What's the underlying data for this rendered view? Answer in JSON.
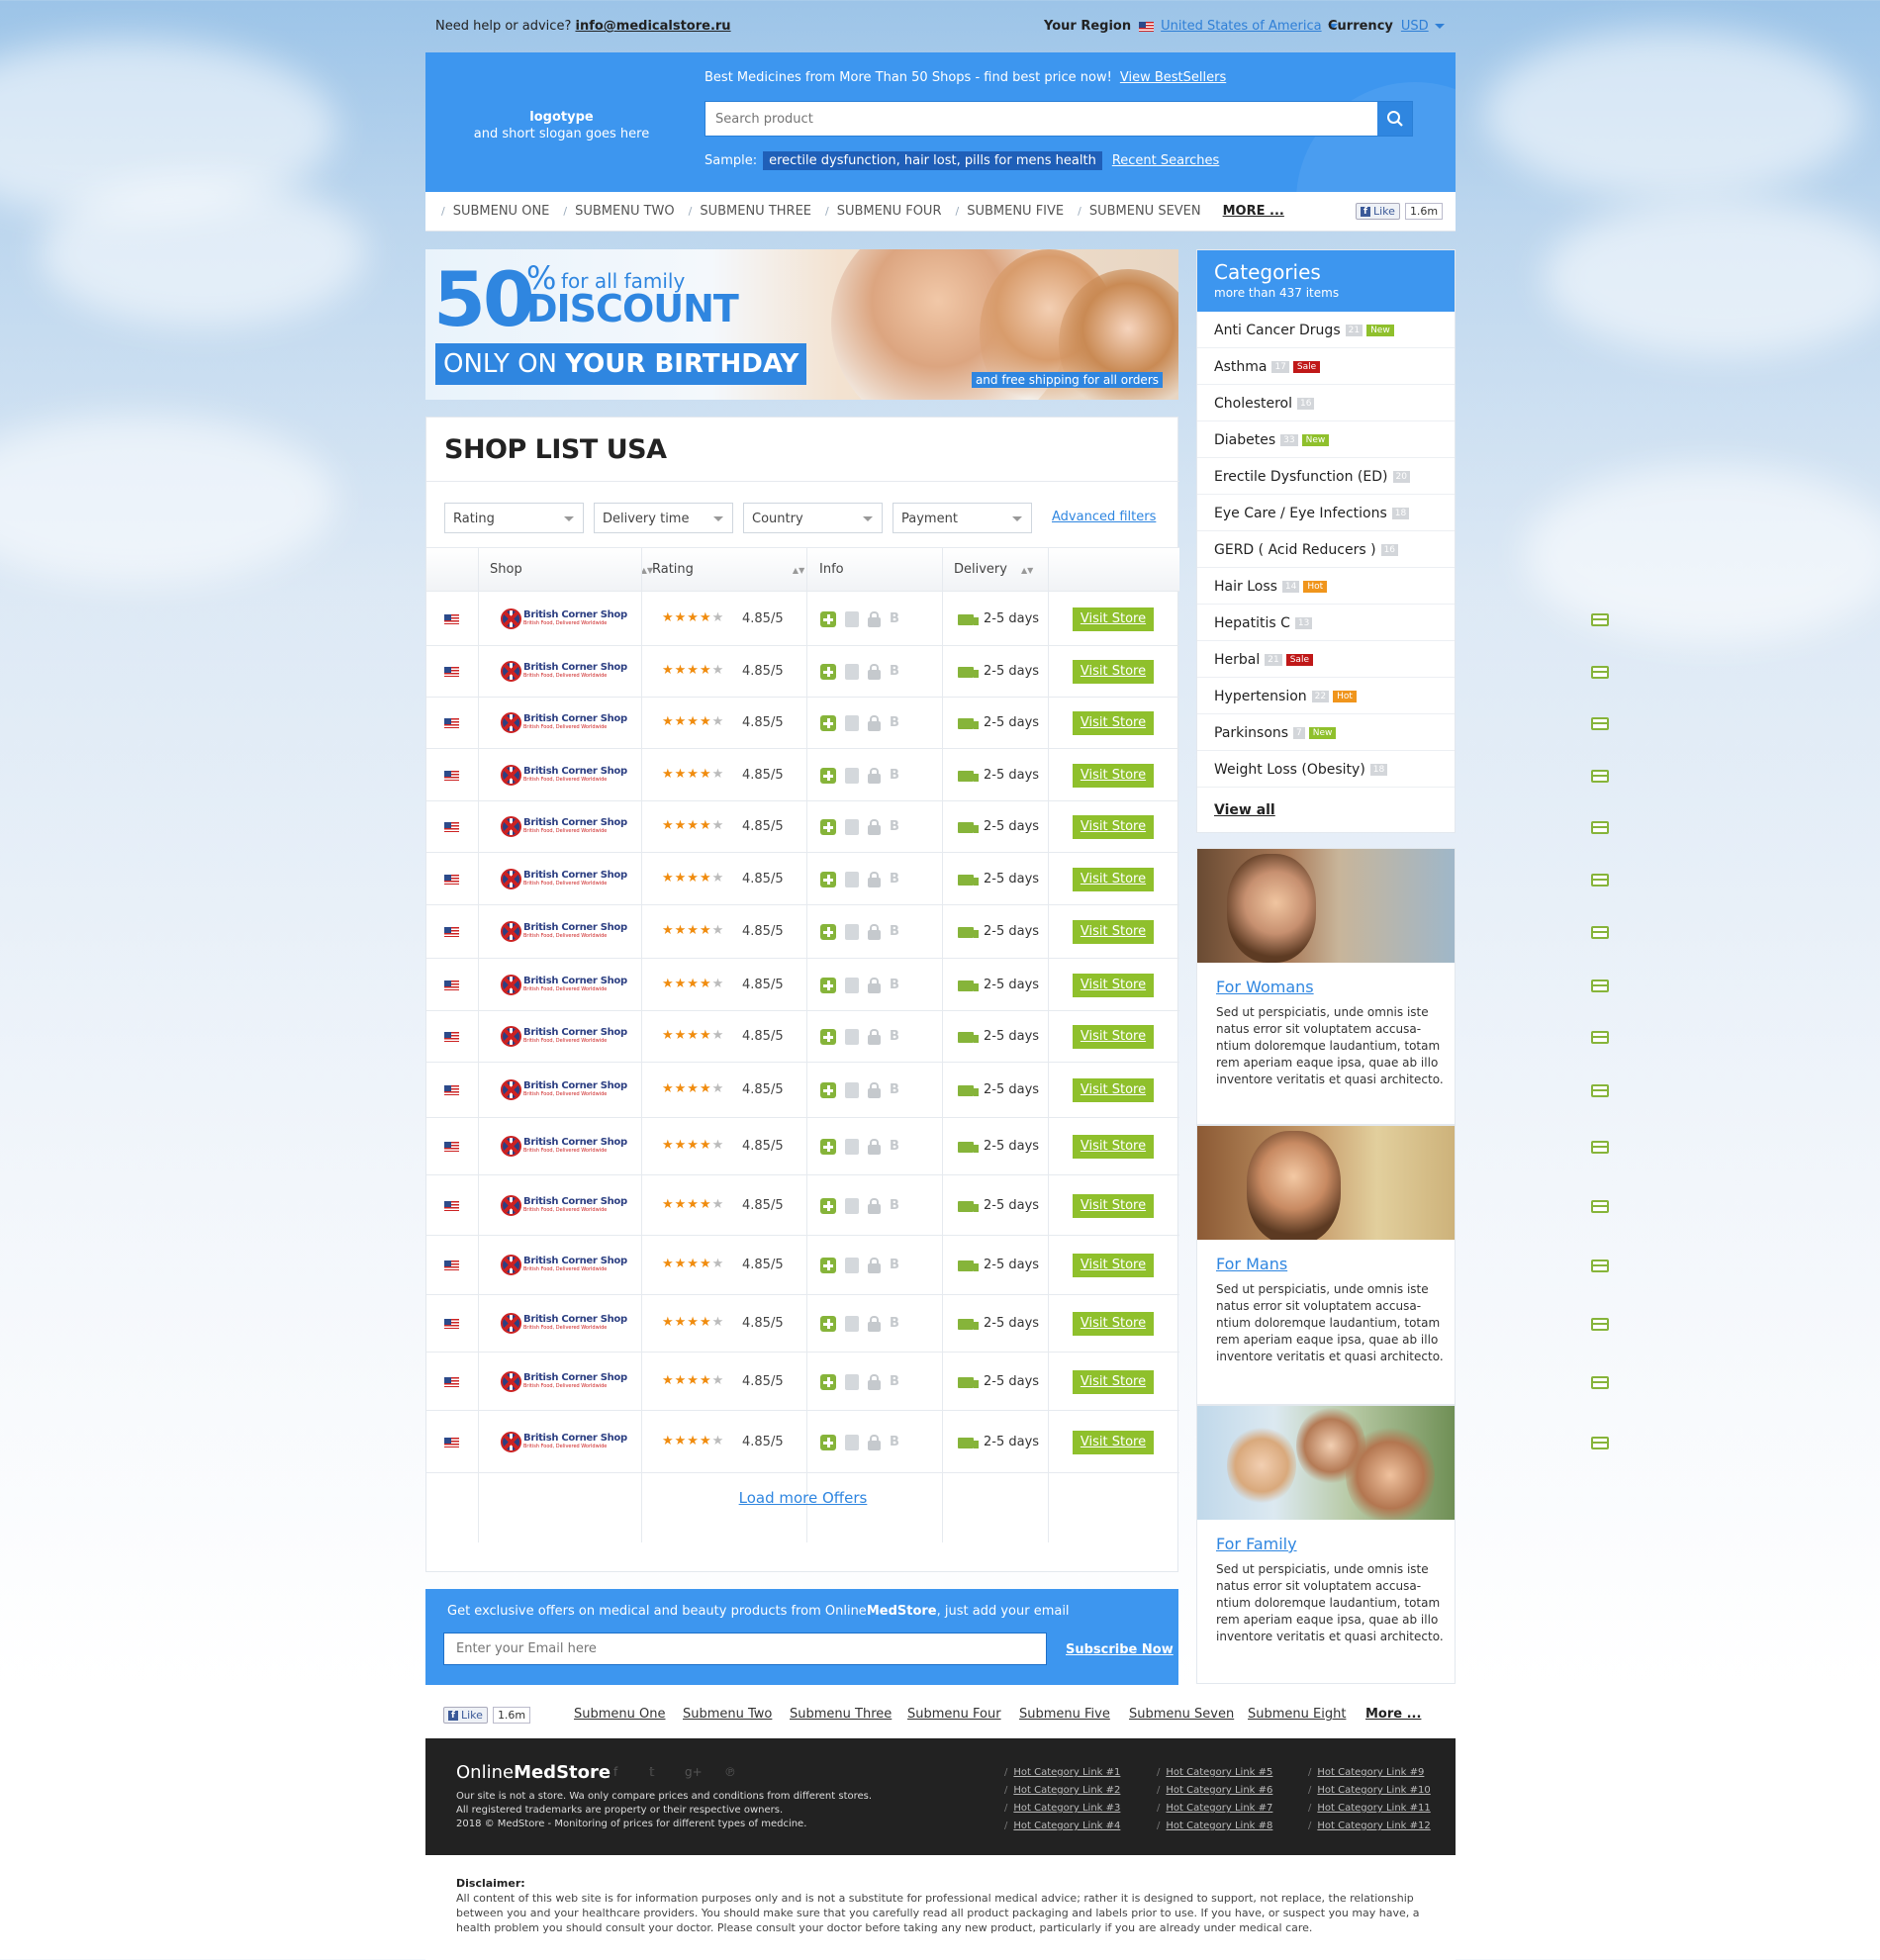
{
  "top": {
    "help_text": "Need help or advice?",
    "help_email": "info@medicalstore.ru",
    "region_label": "Your Region",
    "region_value": "United States of America",
    "currency_label": "Currency",
    "currency_value": "USD"
  },
  "header": {
    "logo_title": "logotype",
    "logo_slogan": "and short slogan goes here",
    "promo_text": "Best Medicines from More Than 50 Shops - find best price now!",
    "promo_link": "View BestSellers",
    "search_placeholder": "Search product",
    "sample_label": "Sample:",
    "sample_value": "erectile dysfunction, hair lost, pills for mens health",
    "recent_searches": "Recent Searches"
  },
  "menu": {
    "items": [
      "SUBMENU ONE",
      "SUBMENU TWO",
      "SUBMENU THREE",
      "SUBMENU FOUR",
      "SUBMENU FIVE",
      "SUBMENU SEVEN"
    ],
    "more": "MORE ...",
    "fb_like": "Like",
    "fb_count": "1.6m"
  },
  "banner": {
    "percent": "50",
    "percent_sign": "%",
    "for_family": "for all family",
    "discount": "DISCOUNT",
    "only_on": "ONLY ON",
    "your_birthday": "YOUR BIRTHDAY",
    "shipping": "and free shipping for all orders"
  },
  "shoplist": {
    "title": "SHOP LIST USA",
    "filters": [
      "Rating",
      "Delivery time",
      "Country",
      "Payment"
    ],
    "advanced": "Advanced filters",
    "columns": {
      "shop": "Shop",
      "rating": "Rating",
      "info": "Info",
      "delivery": "Delivery"
    },
    "shop_name": "British Corner Shop",
    "shop_tagline": "British Food, Delivered Worldwide",
    "score": "4.85/5",
    "delivery": "2-5 days",
    "visit": "Visit Store",
    "rating_stars": 4,
    "load_more": "Load more Offers"
  },
  "subscribe": {
    "text_pre": "Get exclusive offers on medical and beauty products from Online",
    "text_brand": "MedStore",
    "text_post": ", just add your email",
    "placeholder": "Enter your Email here",
    "button": "Subscribe Now"
  },
  "categories": {
    "title": "Categories",
    "subtitle": "more than 437 items",
    "items": [
      {
        "name": "Anti Cancer Drugs",
        "count": "21",
        "badge": "New"
      },
      {
        "name": "Asthma",
        "count": "17",
        "badge": "Sale"
      },
      {
        "name": "Cholesterol",
        "count": "16",
        "badge": ""
      },
      {
        "name": "Diabetes",
        "count": "33",
        "badge": "New"
      },
      {
        "name": "Erectile Dysfunction (ED)",
        "count": "20",
        "badge": ""
      },
      {
        "name": "Eye Care / Eye Infections",
        "count": "18",
        "badge": ""
      },
      {
        "name": "GERD ( Acid Reducers )",
        "count": "16",
        "badge": ""
      },
      {
        "name": "Hair Loss",
        "count": "14",
        "badge": "Hot"
      },
      {
        "name": "Hepatitis C",
        "count": "13",
        "badge": ""
      },
      {
        "name": "Herbal",
        "count": "21",
        "badge": "Sale"
      },
      {
        "name": "Hypertension",
        "count": "22",
        "badge": "Hot"
      },
      {
        "name": "Parkinsons",
        "count": "7",
        "badge": "New"
      },
      {
        "name": "Weight Loss (Obesity)",
        "count": "18",
        "badge": ""
      }
    ],
    "view_all": "View all"
  },
  "cards": [
    {
      "title": "For Womans",
      "text": "Sed ut perspiciatis, unde omnis iste natus error sit voluptatem accusa-ntium doloremque laudantium, totam rem aperiam eaque ipsa, quae ab illo inventore veritatis et quasi architecto."
    },
    {
      "title": "For Mans",
      "text": "Sed ut perspiciatis, unde omnis iste natus error sit voluptatem accusa-ntium doloremque laudantium, totam rem aperiam eaque ipsa, quae ab illo inventore veritatis et quasi architecto."
    },
    {
      "title": "For Family",
      "text": "Sed ut perspiciatis, unde omnis iste natus error sit voluptatem accusa-ntium doloremque laudantium, totam rem aperiam eaque ipsa, quae ab illo inventore veritatis et quasi architecto."
    }
  ],
  "footer_menu": {
    "fb_like": "Like",
    "fb_count": "1.6m",
    "items": [
      "Submenu One",
      "Submenu Two",
      "Submenu Three",
      "Submenu Four",
      "Submenu Five",
      "Submenu Seven",
      "Submenu Eight"
    ],
    "more": "More ..."
  },
  "footer": {
    "brand_pre": "Online",
    "brand_bold": "MedStore",
    "line1": "Our site is not a store. Wa only compare prices and conditions from different stores.",
    "line2": "All registered trademarks are property or their respective owners.",
    "line3": "2018 © MedStore - Monitoring of prices for different types of medcine.",
    "links": [
      "Hot Category Link #1",
      "Hot Category Link #2",
      "Hot Category Link #3",
      "Hot Category Link #4",
      "Hot Category Link #5",
      "Hot Category Link #6",
      "Hot Category Link #7",
      "Hot Category Link #8",
      "Hot Category Link #9",
      "Hot Category Link #10",
      "Hot Category Link #11",
      "Hot Category Link #12"
    ]
  },
  "disclaimer": {
    "title": "Disclaimer:",
    "text": "All content of this web site is for information purposes only and is not a substitute for professional medical advice; rather it is designed to support, not replace, the relationship between you and your healthcare providers. You should make sure that you carefully read all product packaging and labels prior to use. If you have, or suspect you may have, a health problem you should consult your doctor. Please consult your doctor before taking any new product, particularly if you are already under medical care."
  },
  "colors": {
    "accent": "#3d96ef",
    "green": "#8fc02c",
    "sale": "#c01818",
    "hot": "#f0951c"
  }
}
